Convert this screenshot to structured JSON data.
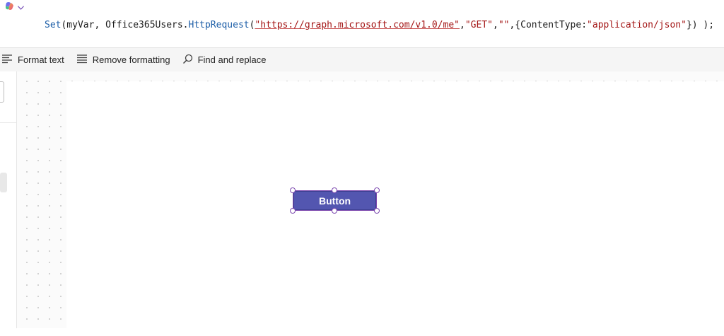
{
  "formula_bar": {
    "copilot_icon": "copilot-icon",
    "expand_icon": "chevron-down-icon",
    "formula_parts": [
      {
        "text": "Set",
        "kind": "fn"
      },
      {
        "text": "(myVar, Office365Users.",
        "kind": "plain"
      },
      {
        "text": "HttpRequest",
        "kind": "fn"
      },
      {
        "text": "(",
        "kind": "plain"
      },
      {
        "text": "\"https://graph.microsoft.com/v1.0/me\"",
        "kind": "url"
      },
      {
        "text": ",",
        "kind": "plain"
      },
      {
        "text": "\"GET\"",
        "kind": "str"
      },
      {
        "text": ",",
        "kind": "plain"
      },
      {
        "text": "\"\"",
        "kind": "str"
      },
      {
        "text": ",{ContentType:",
        "kind": "plain"
      },
      {
        "text": "\"application/json\"",
        "kind": "str"
      },
      {
        "text": "}) );",
        "kind": "plain"
      }
    ]
  },
  "toolbar": {
    "format_text": {
      "label": "Format text",
      "icon": "format-text-icon"
    },
    "remove_formatting": {
      "label": "Remove formatting",
      "icon": "remove-formatting-icon"
    },
    "find_replace": {
      "label": "Find and replace",
      "icon": "search-icon"
    }
  },
  "canvas": {
    "button_label": "Button"
  },
  "colors": {
    "accent": "#5356b0",
    "selection": "#7e4bb0",
    "function_token": "#1e5fa8",
    "string_token": "#a31515"
  }
}
